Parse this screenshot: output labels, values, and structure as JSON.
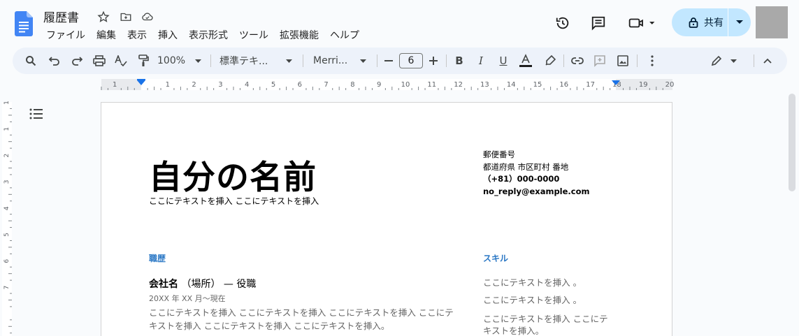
{
  "document": {
    "title": "履歴書"
  },
  "menu": [
    "ファイル",
    "編集",
    "表示",
    "挿入",
    "表示形式",
    "ツール",
    "拡張機能",
    "ヘルプ"
  ],
  "share": {
    "label": "共有"
  },
  "toolbar": {
    "zoom": "100%",
    "style": "標準テキ...",
    "font": "Merri...",
    "font_size": "6"
  },
  "ruler": {
    "labels": [
      "1",
      "1",
      "2",
      "3",
      "4",
      "5",
      "6",
      "7",
      "8",
      "9",
      "10",
      "11",
      "12",
      "13",
      "14",
      "15",
      "16",
      "17",
      "18",
      "19",
      "20"
    ]
  },
  "vruler": {
    "labels": [
      "1",
      "1",
      "2",
      "3",
      "4",
      "5",
      "6",
      "7"
    ]
  },
  "resume": {
    "name": "自分の名前",
    "subtitle": "ここにテキストを挿入 ここにテキストを挿入",
    "contact": {
      "postal": "郵便番号",
      "address": "都道府県 市区町村 番地",
      "phone": "（+81）000-0000",
      "email": "no_reply@example.com"
    },
    "experience_heading": "職歴",
    "job": {
      "company": "会社名",
      "location": "（場所）",
      "dash": "— 役職"
    },
    "dates": "20XX 年 XX 月〜現在",
    "job_description": "ここにテキストを挿入 ここにテキストを挿入 ここにテキストを挿入 ここにテキストを挿入 ここにテキストを挿入 ここにテキストを挿入。",
    "skills_heading": "スキル",
    "skills": [
      "ここにテキストを挿入 。",
      "ここにテキストを挿入 。",
      "ここにテキストを挿入 ここにテキストを挿入。"
    ]
  },
  "colors": {
    "accent": "#2b78c5",
    "share_bg": "#c2e7ff",
    "doc_icon": "#4285f4"
  }
}
